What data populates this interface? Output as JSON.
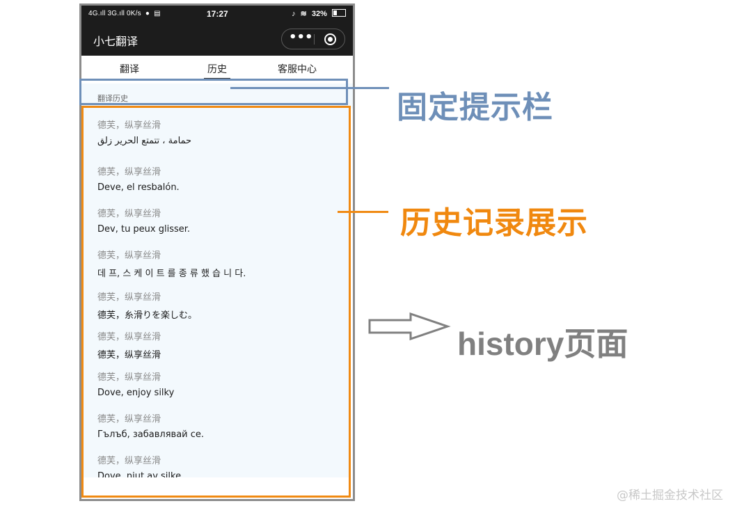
{
  "status_bar": {
    "left": "4G.ıll 3G.ıll 0K/s",
    "time": "17:27",
    "right_battery": "32%"
  },
  "header": {
    "title": "小七翻译"
  },
  "tabs": [
    {
      "label": "翻译",
      "active": false
    },
    {
      "label": "历史",
      "active": true
    },
    {
      "label": "客服中心",
      "active": false
    }
  ],
  "hint_bar": {
    "text": "翻译历史"
  },
  "history": [
    {
      "source": "德芙，纵享丝滑",
      "translation": "حمامة ، تتمتع الحرير زلق"
    },
    {
      "source": "德芙，纵享丝滑",
      "translation": "Deve, el resbalón."
    },
    {
      "source": "德芙，纵享丝滑",
      "translation": "Dev, tu peux glisser."
    },
    {
      "source": "德芙，纵享丝滑",
      "translation": "데 프, 스 케 이 트 를 종 류 했 습 니 다."
    },
    {
      "source": "德芙，纵享丝滑",
      "translation": "德芙，糸滑りを楽しむ。"
    },
    {
      "source": "德芙，纵享丝滑",
      "translation": "德芙，纵享丝滑"
    },
    {
      "source": "德芙，纵享丝滑",
      "translation": "Dove, enjoy silky"
    },
    {
      "source": "德芙，纵享丝滑",
      "translation": "Гълъб, забавлявай се."
    },
    {
      "source": "德芙，纵享丝滑",
      "translation": "Dove, njut av silke"
    }
  ],
  "annotations": {
    "fixed_bar_label": "固定提示栏",
    "history_label": "历史记录展示",
    "page_label": "history页面",
    "fixed_color": "#6e8fb8",
    "history_color": "#f08a13",
    "page_color": "#808080"
  },
  "watermark": "@稀土掘金技术社区",
  "icons": [
    "signal-icon",
    "message-icon",
    "mute-icon",
    "wifi-icon",
    "battery-icon",
    "more-dots-icon",
    "close-target-icon",
    "arrow-right-icon"
  ]
}
